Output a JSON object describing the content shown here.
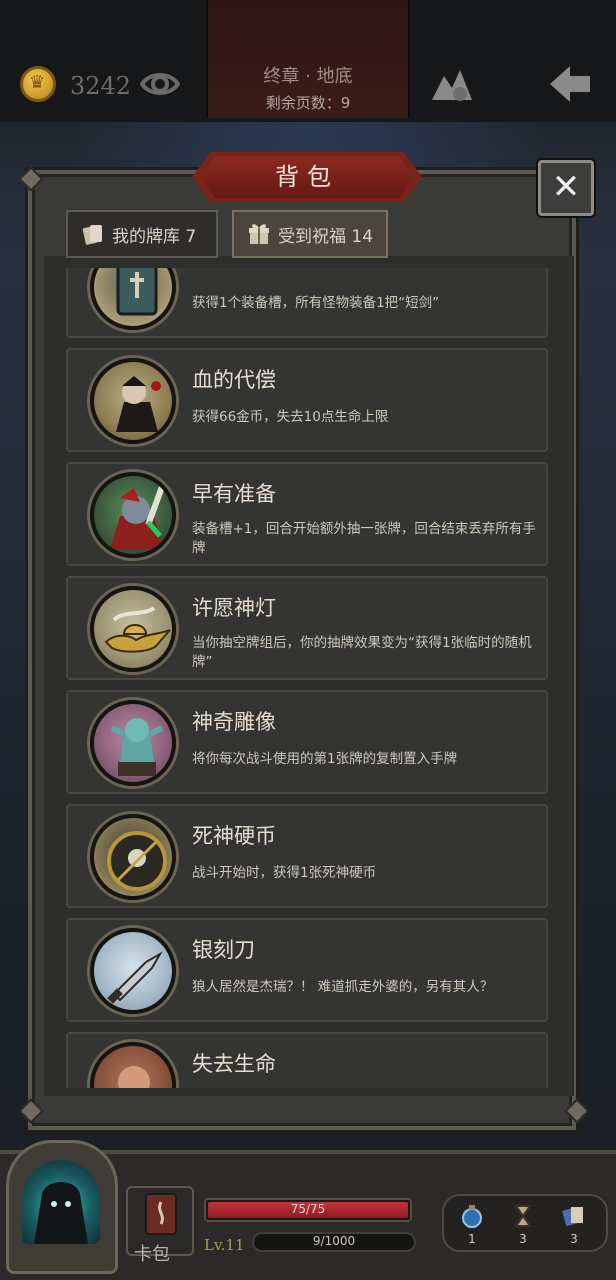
{
  "header": {
    "coins": "3242",
    "chapter": "终章 · 地底",
    "pages_remaining": "剩余页数：9"
  },
  "panel": {
    "title": "背包",
    "close_label": "✕",
    "tabs": [
      {
        "label": "我的牌库 7",
        "active": false
      },
      {
        "label": "受到祝福 14",
        "active": true
      }
    ]
  },
  "blessings": [
    {
      "name": "",
      "desc": "获得1个装备槽，所有怪物装备1把“短剑”"
    },
    {
      "name": "血的代偿",
      "desc": "获得66金币，失去10点生命上限"
    },
    {
      "name": "早有准备",
      "desc": "装备槽+1，回合开始额外抽一张牌，回合结束丢弃所有手牌"
    },
    {
      "name": "许愿神灯",
      "desc": "当你抽空牌组后，你的抽牌效果变为“获得1张临时的随机牌”"
    },
    {
      "name": "神奇雕像",
      "desc": "将你每次战斗使用的第1张牌的复制置入手牌"
    },
    {
      "name": "死神硬币",
      "desc": "战斗开始时，获得1张死神硬币"
    },
    {
      "name": "银刻刀",
      "desc": "狼人居然是杰瑞？！ 难道抓走外婆的，另有其人？"
    },
    {
      "name": "失去生命",
      "desc": ""
    }
  ],
  "footer": {
    "deck_label": "卡包",
    "hp": "75/75",
    "level": "Lv.11",
    "xp": "9/1000",
    "stats": [
      "1",
      "3",
      "3"
    ]
  },
  "colors": {
    "accent_red": "#7b2219",
    "hp_red": "#c2333a",
    "coin_gold": "#f4c94a"
  }
}
